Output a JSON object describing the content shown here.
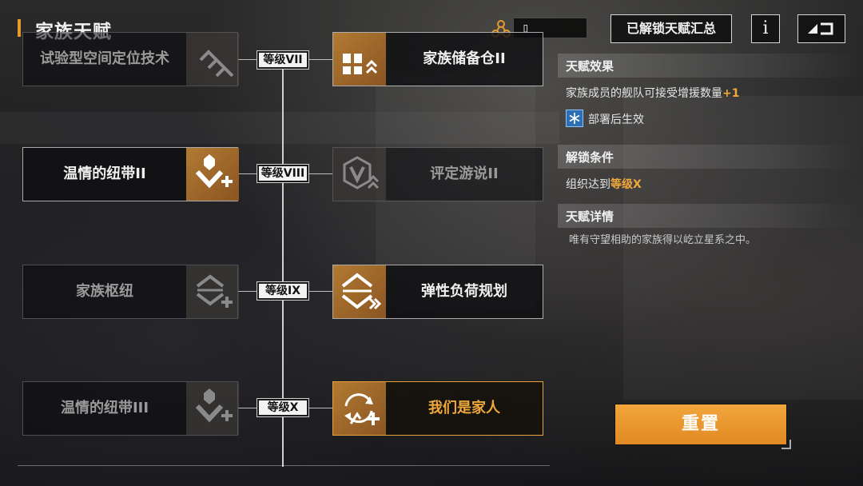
{
  "header": {
    "title": "家族天赋",
    "currency_value": "▯",
    "summary_button": "已解锁天赋汇总",
    "info_button": "i"
  },
  "tree": {
    "rows": [
      {
        "level": "等级VII",
        "left": {
          "label": "试验型空间定位技术",
          "state": "dim"
        },
        "right": {
          "label": "家族储备仓II",
          "state": "active"
        }
      },
      {
        "level": "等级VIII",
        "left": {
          "label": "温情的纽带II",
          "state": "active"
        },
        "right": {
          "label": "评定游说II",
          "state": "dim"
        }
      },
      {
        "level": "等级IX",
        "left": {
          "label": "家族枢纽",
          "state": "dim"
        },
        "right": {
          "label": "弹性负荷规划",
          "state": "active"
        }
      },
      {
        "level": "等级X",
        "left": {
          "label": "温情的纽带III",
          "state": "dim"
        },
        "right": {
          "label": "我们是家人",
          "state": "selected"
        }
      }
    ]
  },
  "detail": {
    "effect_title": "天赋效果",
    "effect_text": "家族成员的舰队可接受增援数量",
    "effect_bonus": "+1",
    "deploy_note": "部署后生效",
    "unlock_title": "解锁条件",
    "unlock_text": "组织达到",
    "unlock_level": "等级X",
    "details_title": "天赋详情",
    "flavor_text": "唯有守望相助的家族得以屹立星系之中。",
    "reset_button": "重置"
  },
  "colors": {
    "accent": "#e59a2e",
    "highlight": "#f0a83a",
    "icon_active": "#a0682a",
    "reset_button": "#e8952c"
  },
  "icons": {
    "currency": "family-points-icon",
    "back": "back-arrow-icon",
    "deploy": "snowflake-deploy-icon"
  }
}
